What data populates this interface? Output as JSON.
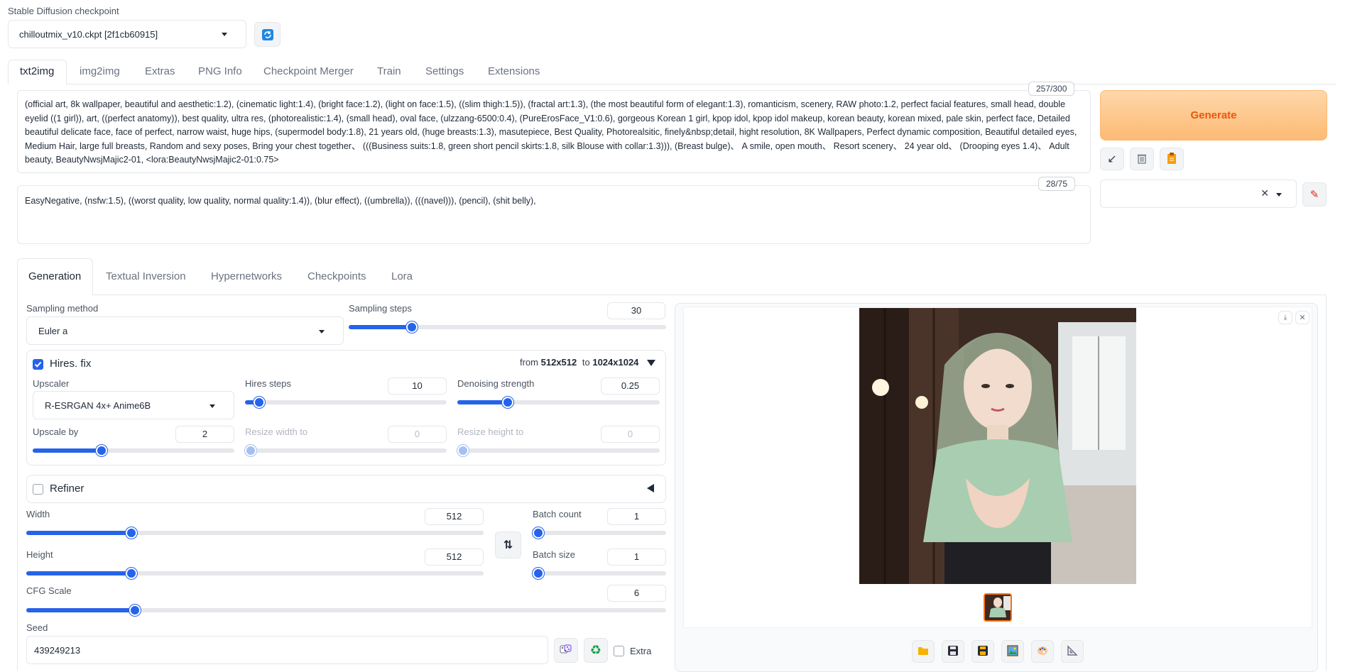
{
  "checkpoint": {
    "label": "Stable Diffusion checkpoint",
    "value": "chilloutmix_v10.ckpt [2f1cb60915]"
  },
  "top_tabs": [
    "txt2img",
    "img2img",
    "Extras",
    "PNG Info",
    "Checkpoint Merger",
    "Train",
    "Settings",
    "Extensions"
  ],
  "prompt": {
    "counter": "257/300",
    "text": "(official art, 8k wallpaper, beautiful and aesthetic:1.2), (cinematic light:1.4), (bright face:1.2), (light on face:1.5), ((slim thigh:1.5)), (fractal art:1.3), (the most beautiful form of elegant:1.3), romanticism, scenery, RAW photo:1.2, perfect facial features, small head, double eyelid  ((1 girl)), art, ((perfect anatomy)), best quality, ultra res, (photorealistic:1.4), (small head), oval face, (ulzzang-6500:0.4), (PureErosFace_V1:0.6), gorgeous Korean 1 girl, kpop idol, kpop idol makeup, korean beauty, korean mixed, pale skin, perfect face, Detailed beautiful delicate face, face of perfect, narrow waist, huge hips, (supermodel body:1.8), 21 years old, (huge breasts:1.3), masutepiece, Best Quality, Photorealsitic, finely&nbsp;detail, hight resolution, 8K Wallpapers, Perfect dynamic composition, Beautiful detailed eyes, Medium Hair, large full breasts, Random and sexy poses, Bring your chest together、 (((Business suits:1.8, green short pencil skirts:1.8, silk Blouse with collar:1.3))), (Breast bulge)、 A smile, open mouth、 Resort scenery、 24 year old、 (Drooping eyes 1.4)、 Adult beauty, BeautyNwsjMajic2-01, <lora:BeautyNwsjMajic2-01:0.75>"
  },
  "negative": {
    "counter": "28/75",
    "text": "EasyNegative, (nsfw:1.5), ((worst quality, low quality, normal quality:1.4)), (blur effect), ((umbrella)), (((navel))), (pencil), (shit belly),"
  },
  "generate_label": "Generate",
  "sub_tabs": [
    "Generation",
    "Textual Inversion",
    "Hypernetworks",
    "Checkpoints",
    "Lora"
  ],
  "sampling": {
    "method_label": "Sampling method",
    "method_value": "Euler a",
    "steps_label": "Sampling steps",
    "steps_value": "30",
    "steps_fraction": 0.2
  },
  "hires": {
    "label": "Hires. fix",
    "checked": true,
    "from_text": "from",
    "from_size": "512x512",
    "to_text": "to",
    "to_size": "1024x1024",
    "upscaler_label": "Upscaler",
    "upscaler_value": "R-ESRGAN 4x+ Anime6B",
    "steps_label": "Hires steps",
    "steps_value": "10",
    "steps_fraction": 0.07,
    "denoise_label": "Denoising strength",
    "denoise_value": "0.25",
    "denoise_fraction": 0.25,
    "upscale_label": "Upscale by",
    "upscale_value": "2",
    "upscale_fraction": 0.34,
    "resize_w_label": "Resize width to",
    "resize_w_value": "0",
    "resize_h_label": "Resize height to",
    "resize_h_value": "0"
  },
  "refiner": {
    "label": "Refiner",
    "checked": false
  },
  "width": {
    "label": "Width",
    "value": "512",
    "fraction": 0.23
  },
  "height": {
    "label": "Height",
    "value": "512",
    "fraction": 0.23
  },
  "batch_count": {
    "label": "Batch count",
    "value": "1",
    "fraction": 0.0
  },
  "batch_size": {
    "label": "Batch size",
    "value": "1",
    "fraction": 0.0
  },
  "cfg": {
    "label": "CFG Scale",
    "value": "6",
    "fraction": 0.17
  },
  "seed": {
    "label": "Seed",
    "value": "439249213",
    "extra_label": "Extra"
  },
  "colors": {
    "accent": "#2563eb",
    "generate_text": "#ea580c",
    "generate_bg": "#fdba74"
  }
}
